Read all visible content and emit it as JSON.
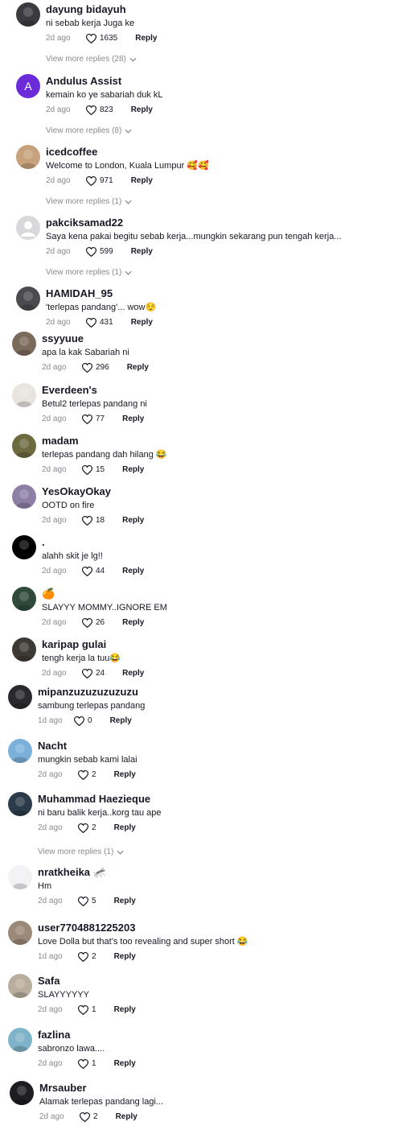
{
  "comments": [
    {
      "name": "dayung bidayuh",
      "text": "ni sebab kerja Juga ke",
      "time": "2d ago",
      "likes": "1635",
      "reply": "Reply",
      "more": "View more replies (28)",
      "avatar_color": "#3b3b3f"
    },
    {
      "name": "Andulus Assist",
      "text": "kemain ko ye sabariah duk kL",
      "time": "2d ago",
      "likes": "823",
      "reply": "Reply",
      "more": "View more replies (8)",
      "avatar_color": "#6c2bd9",
      "avatar_letter": "A"
    },
    {
      "name": "icedcoffee",
      "text": "Welcome to London, Kuala Lumpur 🥰🥰",
      "time": "2d ago",
      "likes": "971",
      "reply": "Reply",
      "more": "View more replies (1)",
      "avatar_color": "#c7a27c"
    },
    {
      "name": "pakciksamad22",
      "text": "Saya kena pakai begitu sebab kerja...mungkin sekarang pun tengah kerja...",
      "time": "2d ago",
      "likes": "599",
      "reply": "Reply",
      "more": "View more replies (1)",
      "avatar_color": "#d9d9dc"
    },
    {
      "name": "HAMIDAH_95",
      "text": "'terlepas pandang'... wow😌",
      "time": "2d ago",
      "likes": "431",
      "reply": "Reply",
      "avatar_color": "#4a4a4f"
    },
    {
      "name": "ssyyuue",
      "text": "apa la kak Sabariah ni",
      "time": "2d ago",
      "likes": "296",
      "reply": "Reply",
      "avatar_color": "#7a6a5c"
    },
    {
      "name": "Everdeen's",
      "text": "Betul2 terlepas pandang ni",
      "time": "2d ago",
      "likes": "77",
      "reply": "Reply",
      "avatar_color": "#e8e4e0"
    },
    {
      "name": "madam",
      "text": "terlepas pandang dah hilang 😂",
      "time": "2d ago",
      "likes": "15",
      "reply": "Reply",
      "avatar_color": "#6d6a3f"
    },
    {
      "name": "YesOkayOkay",
      "text": "OOTD on fire",
      "time": "2d ago",
      "likes": "18",
      "reply": "Reply",
      "avatar_color": "#8d7fa6"
    },
    {
      "name": ".",
      "text": "alahh skit je lg!!",
      "time": "2d ago",
      "likes": "44",
      "reply": "Reply",
      "avatar_color": "#000000"
    },
    {
      "name": "🍊",
      "text": "SLAYYY MOMMY..IGNORE EM",
      "time": "2d ago",
      "likes": "26",
      "reply": "Reply",
      "avatar_color": "#2f4a3a"
    },
    {
      "name": "karipap gulai",
      "text": "tengh kerja la tuu😂",
      "time": "2d ago",
      "likes": "24",
      "reply": "Reply",
      "avatar_color": "#3d3a35"
    },
    {
      "name": "mipanzuzuzuzuzuzu",
      "text": "sambung terlepas pandang",
      "time": "1d ago",
      "likes": "0",
      "reply": "Reply",
      "avatar_color": "#2a2a2e"
    },
    {
      "name": "Nacht",
      "text": "mungkin sebab kami lalai",
      "time": "2d ago",
      "likes": "2",
      "reply": "Reply",
      "avatar_color": "#7ab0d9"
    },
    {
      "name": "Muhammad Haezieque",
      "text": "ni baru balik kerja..korg tau ape",
      "time": "2d ago",
      "likes": "2",
      "reply": "Reply",
      "more": "View more replies (1)",
      "avatar_color": "#2b3b4a"
    },
    {
      "name": "nratkheika 🦟",
      "text": "Hm",
      "time": "2d ago",
      "likes": "5",
      "reply": "Reply",
      "avatar_color": "#f2f2f4"
    },
    {
      "name": "user7704881225203",
      "text": "Love Dolla but that's too revealing and super short 😂",
      "time": "1d ago",
      "likes": "2",
      "reply": "Reply",
      "avatar_color": "#9a8878"
    },
    {
      "name": "Safa",
      "text": "SLAYYYYYY",
      "time": "2d ago",
      "likes": "1",
      "reply": "Reply",
      "avatar_color": "#b9ad9d"
    },
    {
      "name": "fazlina",
      "text": "sabronzo lawa....",
      "time": "2d ago",
      "likes": "1",
      "reply": "Reply",
      "avatar_color": "#7fb3c9"
    },
    {
      "name": "Mrsauber",
      "text": "Alamak terlepas pandang lagi...",
      "time": "2d ago",
      "likes": "2",
      "reply": "Reply",
      "avatar_color": "#1d1d22"
    }
  ],
  "icons": {
    "like": "heart-outline-icon",
    "expand": "chevron-down-icon"
  },
  "colors": {
    "meta_grey": "#8a8b91",
    "text": "#161823"
  }
}
